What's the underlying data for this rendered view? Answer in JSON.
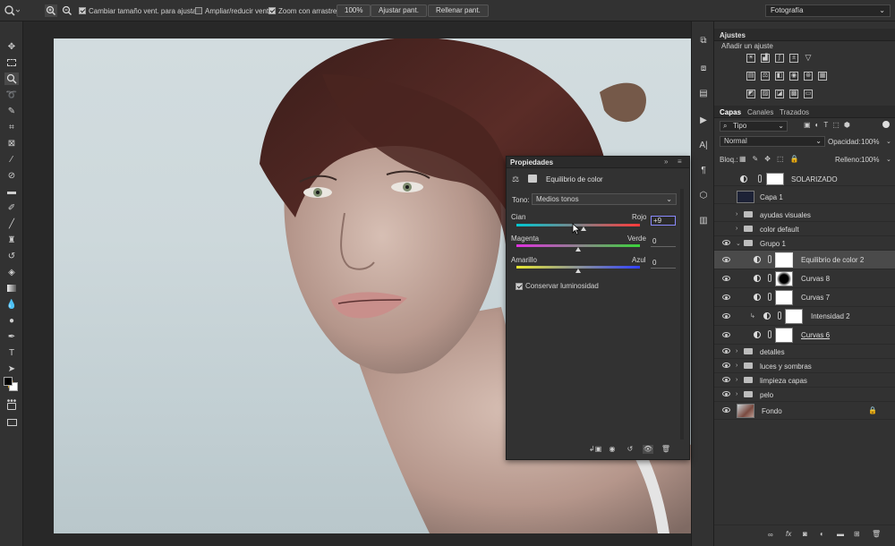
{
  "options_bar": {
    "resize_windows_label": "Cambiar tamaño vent. para ajustar",
    "zoom_all_windows_label": "Ampliar/reducir vent.",
    "scrubby_zoom_label": "Zoom con arrastre",
    "zoom_value": "100%",
    "fit_screen_label": "Ajustar pant.",
    "fill_screen_label": "Rellenar pant.",
    "workspace": "Fotografía"
  },
  "adjustments_panel": {
    "title": "Ajustes",
    "subtitle": "Añadir un ajuste"
  },
  "layers_panel": {
    "tabs": [
      "Capas",
      "Canales",
      "Trazados"
    ],
    "filter_kind": "Tipo",
    "blend_mode": "Normal",
    "opacity_label": "Opacidad:",
    "opacity_value": "100%",
    "lock_label": "Bloq.:",
    "fill_label": "Relleno:",
    "fill_value": "100%",
    "layers": [
      {
        "name": "SOLARIZADO"
      },
      {
        "name": "Capa 1"
      },
      {
        "name": "ayudas visuales"
      },
      {
        "name": "color default"
      },
      {
        "name": "Grupo 1"
      },
      {
        "name": "Equilibrio de color 2"
      },
      {
        "name": "Curvas 8"
      },
      {
        "name": "Curvas 7"
      },
      {
        "name": "Intensidad 2"
      },
      {
        "name": "Curvas 6"
      },
      {
        "name": "detalles"
      },
      {
        "name": "luces y sombras"
      },
      {
        "name": "limpieza capas"
      },
      {
        "name": "pelo"
      },
      {
        "name": "Fondo"
      }
    ],
    "footer_fx": "fx"
  },
  "properties_panel": {
    "title": "Propiedades",
    "adjustment_name": "Equilibrio de color",
    "tone_label": "Tono:",
    "tone_value": "Medios tonos",
    "sliders": [
      {
        "left": "Cian",
        "right": "Rojo",
        "value": "+9",
        "position": 0.54
      },
      {
        "left": "Magenta",
        "right": "Verde",
        "value": "0",
        "position": 0.5
      },
      {
        "left": "Amarillo",
        "right": "Azul",
        "value": "0",
        "position": 0.5
      }
    ],
    "preserve_luminosity_label": "Conservar luminosidad"
  },
  "colors": {
    "panel_bg": "#323232",
    "app_bg": "#282828",
    "selected_layer": "#4a4a4a"
  }
}
